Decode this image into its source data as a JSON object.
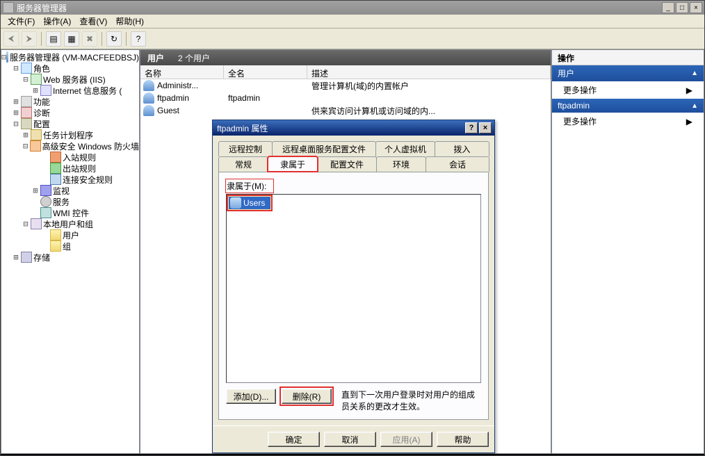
{
  "window": {
    "title": "服务器管理器"
  },
  "menu": {
    "file": "文件(F)",
    "action": "操作(A)",
    "view": "查看(V)",
    "help": "帮助(H)"
  },
  "tree": {
    "root": "服务器管理器 (VM-MACFEEDBSJ)",
    "roles": "角色",
    "web": "Web 服务器 (IIS)",
    "iis": "Internet 信息服务 (",
    "features": "功能",
    "diag": "诊断",
    "config": "配置",
    "task": "任务计划程序",
    "fw": "高级安全 Windows 防火墙",
    "inbound": "入站规则",
    "outbound": "出站规则",
    "consec": "连接安全规则",
    "monitor": "监视",
    "services": "服务",
    "wmi": "WMI 控件",
    "lug": "本地用户和组",
    "users": "用户",
    "groups": "组",
    "storage": "存储"
  },
  "list": {
    "header_label": "用户",
    "header_count": "2 个用户",
    "col_name": "名称",
    "col_full": "全名",
    "col_desc": "描述",
    "rows": [
      {
        "name": "Administr...",
        "full": "",
        "desc": "管理计算机(域)的内置帐户"
      },
      {
        "name": "ftpadmin",
        "full": "ftpadmin",
        "desc": ""
      },
      {
        "name": "Guest",
        "full": "",
        "desc": "供来宾访问计算机或访问域的内..."
      }
    ]
  },
  "actions": {
    "title": "操作",
    "sec1": "用户",
    "more1": "更多操作",
    "sec2": "ftpadmin",
    "more2": "更多操作"
  },
  "dialog": {
    "title": "ftpadmin 属性",
    "tabs_row1": [
      "远程控制",
      "远程桌面服务配置文件",
      "个人虚拟机",
      "拨入"
    ],
    "tabs_row2": [
      "常规",
      "隶属于",
      "配置文件",
      "环境",
      "会话"
    ],
    "member_of_label": "隶属于(M):",
    "member_item": "Users",
    "btn_add": "添加(D)...",
    "btn_remove": "删除(R)",
    "note": "直到下一次用户登录时对用户的组成员关系的更改才生效。",
    "btn_ok": "确定",
    "btn_cancel": "取消",
    "btn_apply": "应用(A)",
    "btn_help": "帮助"
  }
}
